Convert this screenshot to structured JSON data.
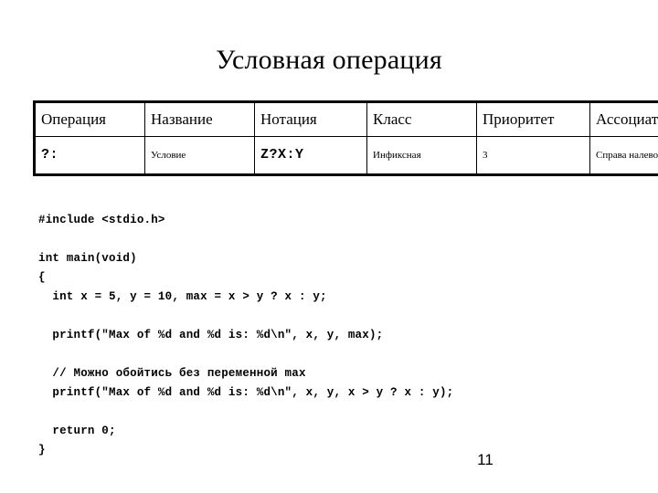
{
  "slide": {
    "title": "Условная операция",
    "page_number": "11",
    "background_color": "#ffffff",
    "text_color": "#000000"
  },
  "table": {
    "border_color": "#000000",
    "headers": [
      "Операция",
      "Название",
      "Нотация",
      "Класс",
      "Приоритет",
      "Ассоциат."
    ],
    "rows": [
      {
        "operation": "?:",
        "name": "Условие",
        "notation": "Z?X:Y",
        "class": "Инфиксная",
        "priority": "3",
        "associativity": "Справа налево"
      }
    ]
  },
  "code": {
    "language": "c",
    "lines": [
      "#include <stdio.h>",
      "",
      "int main(void)",
      "{",
      "  int x = 5, y = 10, max = x > y ? x : y;",
      "",
      "  printf(\"Max of %d and %d is: %d\\n\", x, y, max);",
      "",
      "  // Можно обойтись без переменной max",
      "  printf(\"Max of %d and %d is: %d\\n\", x, y, x > y ? x : y);",
      "",
      "  return 0;",
      "}"
    ],
    "text": "#include <stdio.h>\n\nint main(void)\n{\n  int x = 5, y = 10, max = x > y ? x : y;\n\n  printf(\"Max of %d and %d is: %d\\n\", x, y, max);\n\n  // Можно обойтись без переменной max\n  printf(\"Max of %d and %d is: %d\\n\", x, y, x > y ? x : y);\n\n  return 0;\n}"
  }
}
